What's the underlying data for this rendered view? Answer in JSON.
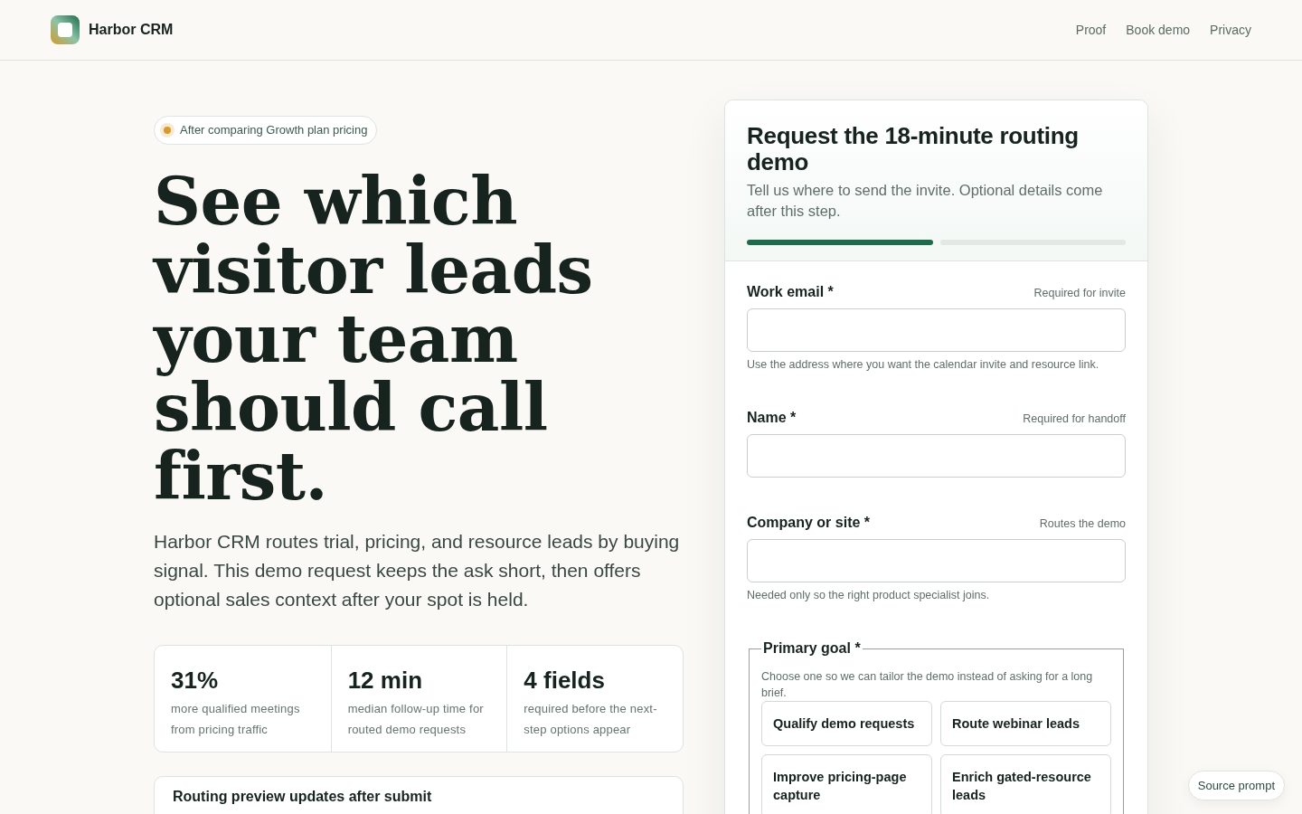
{
  "header": {
    "brand": "Harbor CRM",
    "nav": [
      {
        "label": "Proof"
      },
      {
        "label": "Book demo"
      },
      {
        "label": "Privacy"
      }
    ]
  },
  "hero": {
    "badge": "After comparing Growth plan pricing",
    "title": "See which visitor leads your team should call first.",
    "description": "Harbor CRM routes trial, pricing, and resource leads by buying signal. This demo request keeps the ask short, then offers optional sales context after your spot is held.",
    "stats": [
      {
        "value": "31%",
        "label": "more qualified meetings from pricing traffic"
      },
      {
        "value": "12 min",
        "label": "median follow-up time for routed demo requests"
      },
      {
        "value": "4 fields",
        "label": "required before the next-step options appear"
      }
    ],
    "preview_card": {
      "title": "Routing preview updates after submit"
    }
  },
  "form": {
    "title": "Request the 18-minute routing demo",
    "subtitle": "Tell us where to send the invite. Optional details come after this step.",
    "progress_steps": [
      {
        "completed": true
      },
      {
        "completed": false
      }
    ],
    "fields": [
      {
        "label": "Work email *",
        "hint": "Required for invite",
        "help": "Use the address where you want the calendar invite and resource link."
      },
      {
        "label": "Name *",
        "hint": "Required for handoff"
      },
      {
        "label": "Company or site *",
        "hint": "Routes the demo",
        "help": "Needed only so the right product specialist joins."
      }
    ],
    "goal": {
      "legend": "Primary goal *",
      "description": "Choose one so we can tailor the demo instead of asking for a long brief.",
      "options": [
        {
          "label": "Qualify demo requests",
          "selected": false
        },
        {
          "label": "Route webinar leads",
          "selected": false
        },
        {
          "label": "Improve pricing-page capture",
          "selected": false
        },
        {
          "label": "Enrich gated-resource leads",
          "selected": false
        }
      ]
    }
  },
  "source_prompt_button": "Source prompt"
}
